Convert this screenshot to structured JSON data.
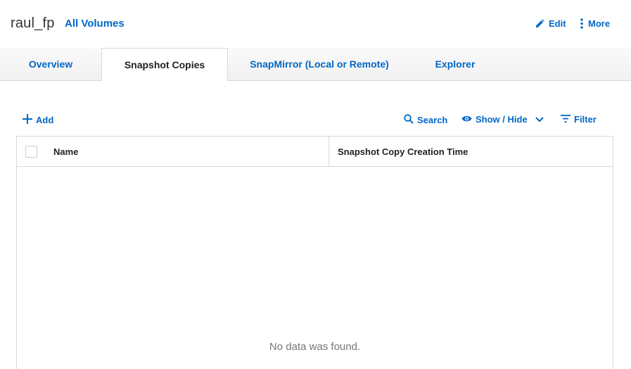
{
  "header": {
    "volume_name": "raul_fp",
    "breadcrumb": "All Volumes",
    "actions": {
      "edit_label": "Edit",
      "edit_icon": "pencil-icon",
      "more_label": "More",
      "more_icon": "vertical-dots-icon"
    }
  },
  "tabs": [
    {
      "label": "Overview",
      "active": false
    },
    {
      "label": "Snapshot Copies",
      "active": true
    },
    {
      "label": "SnapMirror (Local or Remote)",
      "active": false
    },
    {
      "label": "Explorer",
      "active": false
    }
  ],
  "toolbar": {
    "add_label": "Add",
    "search_label": "Search",
    "show_hide_label": "Show / Hide",
    "filter_label": "Filter"
  },
  "table": {
    "columns": [
      "Name",
      "Snapshot Copy Creation Time"
    ],
    "rows": [],
    "empty_message": "No data was found."
  },
  "colors": {
    "accent": "#0067c5",
    "border": "#d9d9d9",
    "text": "#333333"
  }
}
